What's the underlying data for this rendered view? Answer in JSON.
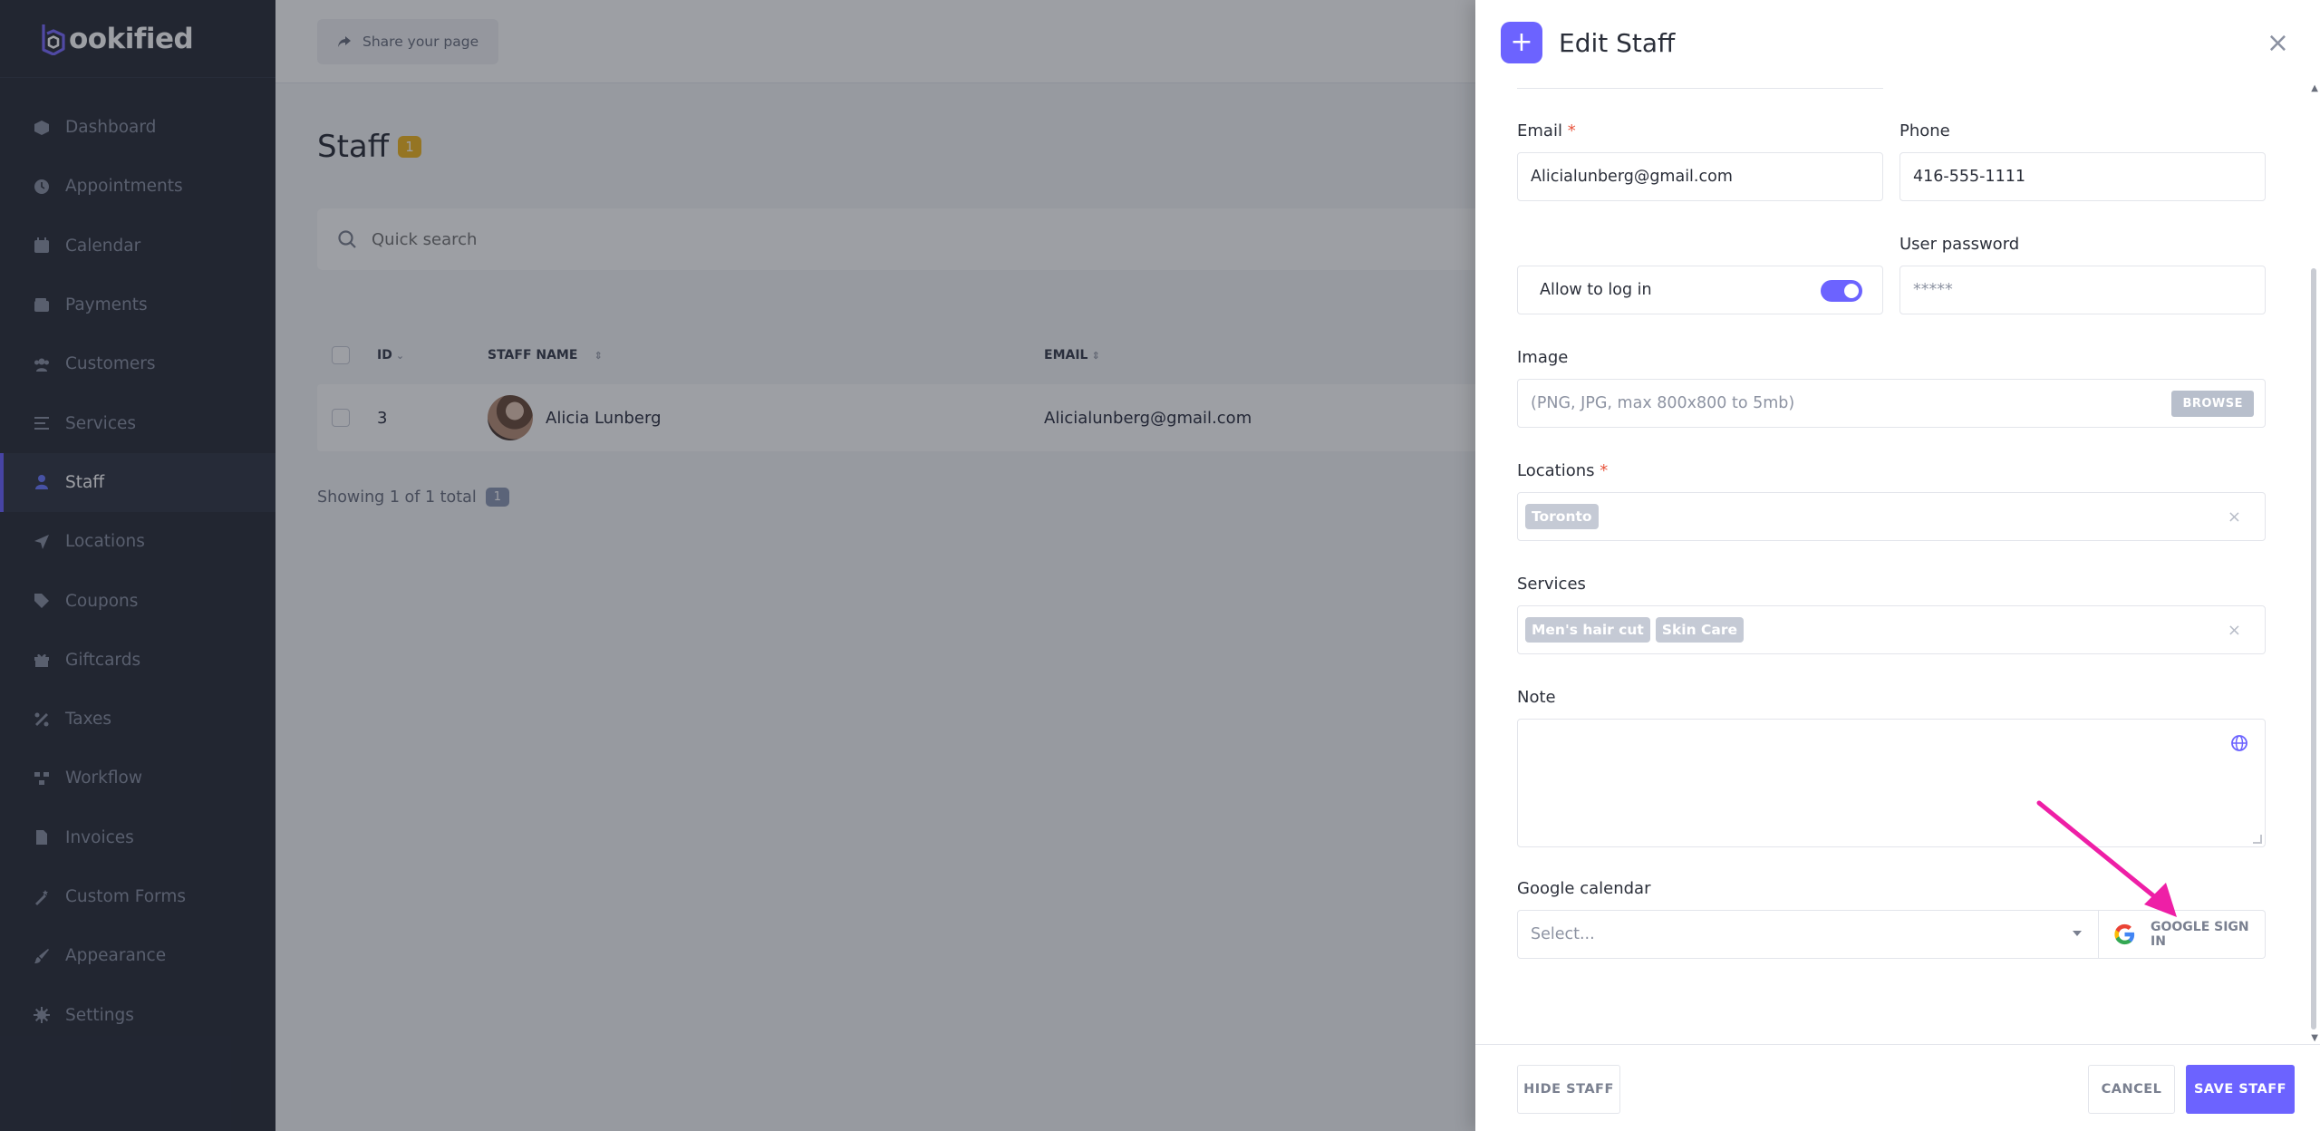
{
  "brand": {
    "logo_text": "ookified",
    "accent": "#6c63ff"
  },
  "sidebar": {
    "items": [
      {
        "label": "Dashboard",
        "icon": "dashboard-icon"
      },
      {
        "label": "Appointments",
        "icon": "clock-icon"
      },
      {
        "label": "Calendar",
        "icon": "calendar-icon"
      },
      {
        "label": "Payments",
        "icon": "wallet-icon"
      },
      {
        "label": "Customers",
        "icon": "users-icon"
      },
      {
        "label": "Services",
        "icon": "list-icon"
      },
      {
        "label": "Staff",
        "icon": "user-icon",
        "active": true
      },
      {
        "label": "Locations",
        "icon": "location-arrow-icon"
      },
      {
        "label": "Coupons",
        "icon": "tag-icon"
      },
      {
        "label": "Giftcards",
        "icon": "gift-icon"
      },
      {
        "label": "Taxes",
        "icon": "percent-icon"
      },
      {
        "label": "Workflow",
        "icon": "workflow-icon"
      },
      {
        "label": "Invoices",
        "icon": "file-icon"
      },
      {
        "label": "Custom Forms",
        "icon": "magic-wand-icon"
      },
      {
        "label": "Appearance",
        "icon": "brush-icon"
      },
      {
        "label": "Settings",
        "icon": "gear-icon"
      }
    ]
  },
  "topbar": {
    "share_label": "Share your page"
  },
  "page": {
    "title": "Staff",
    "count": "1"
  },
  "search": {
    "placeholder": "Quick search"
  },
  "table": {
    "columns": {
      "id": "ID",
      "name": "STAFF NAME",
      "email": "EMAIL"
    },
    "rows": [
      {
        "id": "3",
        "name": "Alicia Lunberg",
        "email": "Alicialunberg@gmail.com"
      }
    ],
    "showing": "Showing 1 of 1 total",
    "page": "1"
  },
  "drawer": {
    "title": "Edit Staff",
    "plus": "+",
    "close": "×",
    "email": {
      "label": "Email",
      "required": "*",
      "value": "Alicialunberg@gmail.com"
    },
    "phone": {
      "label": "Phone",
      "value": "416-555-1111"
    },
    "allow_login": {
      "label": "Allow to log in",
      "on": true
    },
    "password": {
      "label": "User password",
      "value": "*****"
    },
    "image": {
      "label": "Image",
      "placeholder": "(PNG, JPG, max 800x800 to 5mb)",
      "browse": "BROWSE"
    },
    "locations": {
      "label": "Locations",
      "required": "*",
      "tags": [
        "Toronto"
      ]
    },
    "services": {
      "label": "Services",
      "tags": [
        "Men's hair cut",
        "Skin Care"
      ]
    },
    "note": {
      "label": "Note"
    },
    "google": {
      "label": "Google calendar",
      "select_placeholder": "Select...",
      "signin": "GOOGLE SIGN IN"
    },
    "footer": {
      "hide": "HIDE STAFF",
      "cancel": "CANCEL",
      "save": "SAVE STAFF"
    }
  },
  "annotation": {
    "arrow_color": "#ee1fa6"
  }
}
